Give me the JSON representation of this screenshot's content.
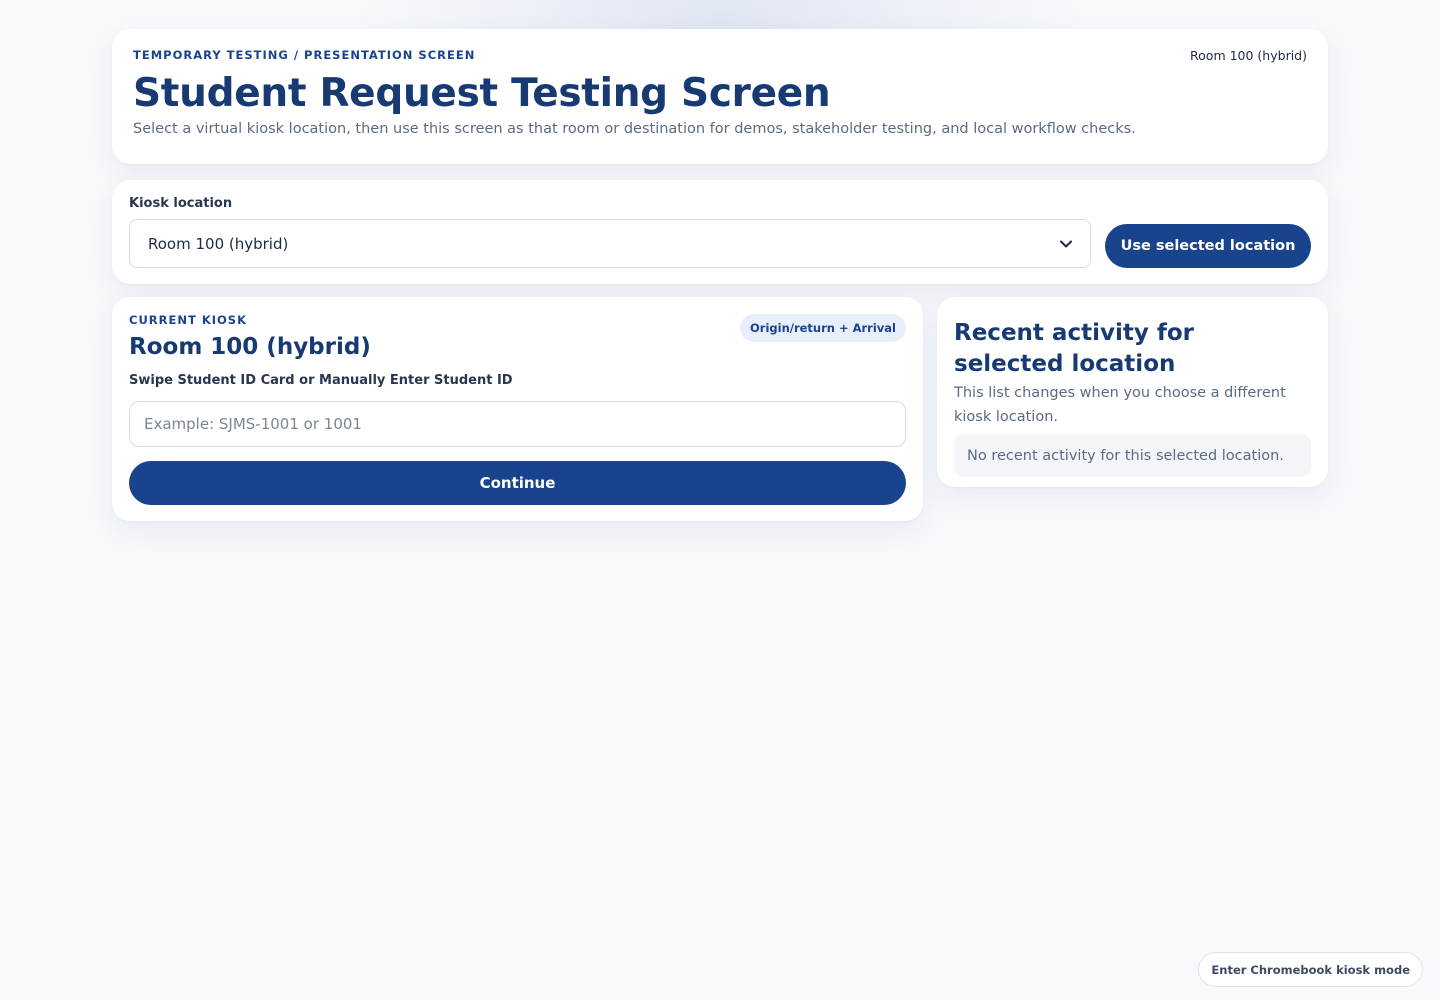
{
  "header": {
    "eyebrow": "TEMPORARY TESTING / PRESENTATION SCREEN",
    "title": "Student Request Testing Screen",
    "subtitle": "Select a virtual kiosk location, then use this screen as that room or destination for demos, stakeholder testing, and local workflow checks.",
    "current_location": "Room 100 (hybrid)"
  },
  "location_picker": {
    "label": "Kiosk location",
    "selected": "Room 100 (hybrid)",
    "button_label": "Use selected location"
  },
  "kiosk": {
    "eyebrow": "CURRENT KIOSK",
    "title": "Room 100 (hybrid)",
    "mode_badge": "Origin/return + Arrival",
    "input_label": "Swipe Student ID Card or Manually Enter Student ID",
    "input_placeholder": "Example: SJMS-1001 or 1001",
    "input_value": "",
    "continue_label": "Continue"
  },
  "activity": {
    "title": "Recent activity for selected location",
    "subtitle": "This list changes when you choose a different kiosk location.",
    "empty_message": "No recent activity for this selected location."
  },
  "footer": {
    "kiosk_mode_label": "Enter Chromebook kiosk mode"
  },
  "colors": {
    "primary": "#1a438e",
    "heading": "#173a73",
    "background": "#f7f9fc"
  }
}
